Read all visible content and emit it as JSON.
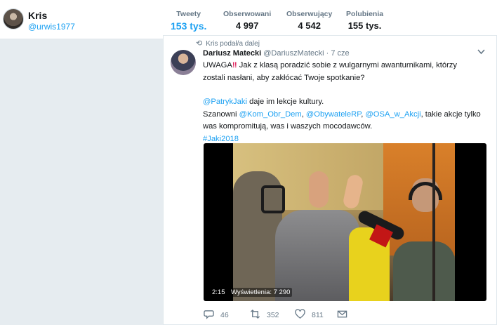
{
  "profile": {
    "name": "Kris",
    "handle": "@urwis1977"
  },
  "stats": [
    {
      "label": "Tweety",
      "value": "153 tys."
    },
    {
      "label": "Obserwowani",
      "value": "4 997"
    },
    {
      "label": "Obserwujący",
      "value": "4 542"
    },
    {
      "label": "Polubienia",
      "value": "155 tys."
    }
  ],
  "tweet": {
    "retweet_line": "Kris podał/a dalej",
    "author": "Dariusz Matecki",
    "author_handle": "@DariuszMatecki",
    "separator": "·",
    "time": "7 cze",
    "text": {
      "l1_a": "UWAGA",
      "l1_b": "‼",
      "l1_c": " Jak z klasą poradzić sobie z wulgarnymi awanturnikami, którzy",
      "l2": "zostali nasłani, aby zakłócać Twoje spotkanie?",
      "l3_mention": "@PatrykJaki",
      "l3_rest": " daje im lekcje kultury.",
      "l4_a": "Szanowni ",
      "l4_m1": "@Kom_Obr_Dem",
      "l4_sep1": ", ",
      "l4_m2": "@ObywateleRP",
      "l4_sep2": ", ",
      "l4_m3": "@OSA_w_Akcji",
      "l4_rest": ", takie akcje tylko",
      "l5": "was kompromitują, was i waszych mocodawców.",
      "hashtag": "#Jaki2018"
    },
    "video": {
      "duration": "2:15",
      "views": "Wyświetlenia: 7 290"
    },
    "actions": {
      "replies": "46",
      "retweets": "352",
      "likes": "811"
    }
  },
  "colors": {
    "accent": "#1da1f2",
    "muted": "#657786",
    "background": "#e6ecf0",
    "alert": "#e0245e"
  }
}
